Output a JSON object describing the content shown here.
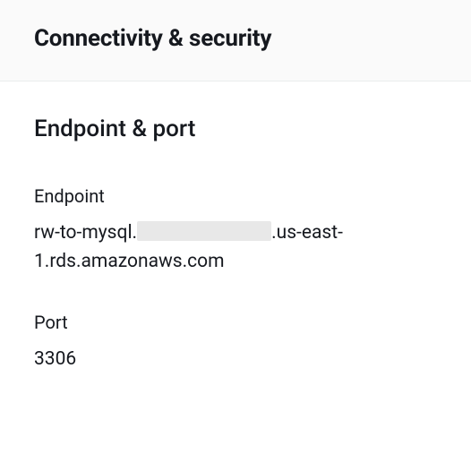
{
  "tab": {
    "title": "Connectivity & security"
  },
  "section": {
    "title": "Endpoint & port"
  },
  "endpoint": {
    "label": "Endpoint",
    "prefix": "rw-to-mysql.",
    "suffix": ".us-east-1.rds.amazonaws.com"
  },
  "port": {
    "label": "Port",
    "value": "3306"
  }
}
